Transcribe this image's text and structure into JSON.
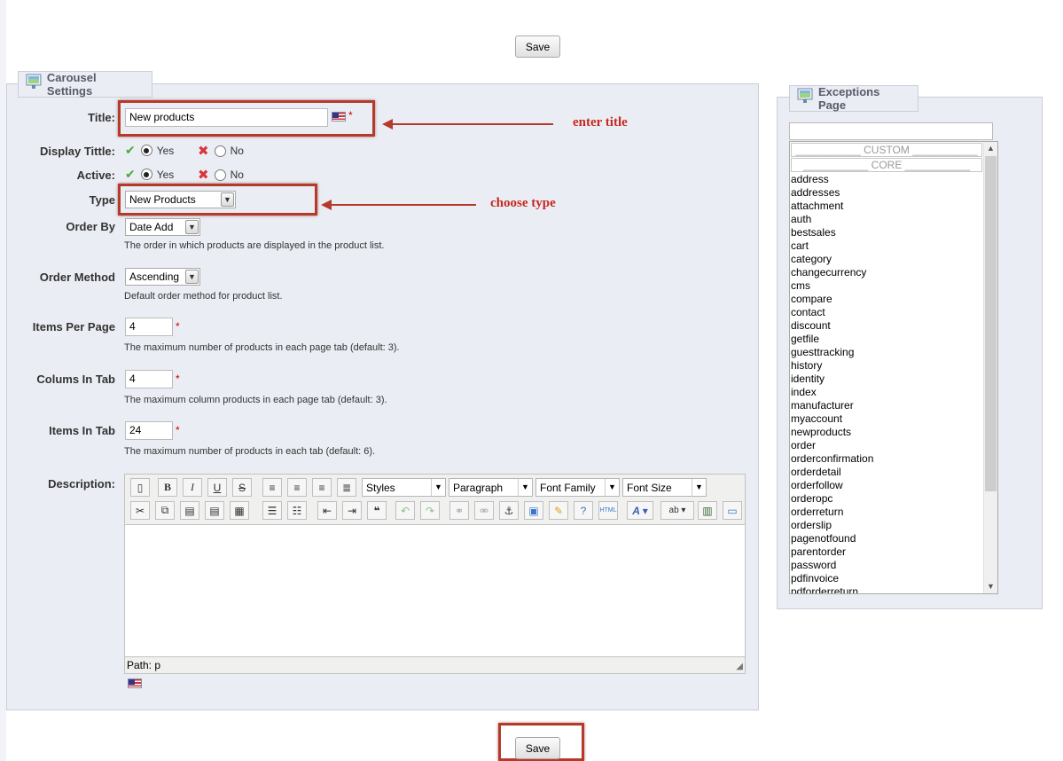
{
  "buttons": {
    "save_top": "Save",
    "save_bottom": "Save"
  },
  "carousel": {
    "legend": "Carousel Settings",
    "title_label": "Title:",
    "title_value": "New products",
    "display_title_label": "Display Tittle:",
    "active_label": "Active:",
    "yes": "Yes",
    "no": "No",
    "type_label": "Type",
    "type_value": "New Products",
    "order_by_label": "Order By",
    "order_by_value": "Date Add",
    "order_by_hint": "The order in which products are displayed in the product list.",
    "order_method_label": "Order Method",
    "order_method_value": "Ascending",
    "order_method_hint": "Default order method for product list.",
    "items_per_page_label": "Items Per Page",
    "items_per_page_value": "4",
    "items_per_page_hint": "The maximum number of products in each page tab (default: 3).",
    "columns_label": "Colums In Tab",
    "columns_value": "4",
    "columns_hint": "The maximum column products in each page tab (default: 3).",
    "items_in_tab_label": "Items In Tab",
    "items_in_tab_value": "24",
    "items_in_tab_hint": "The maximum number of products in each tab (default: 6).",
    "description_label": "Description:",
    "required_mark": "*"
  },
  "editor": {
    "styles": "Styles",
    "paragraph": "Paragraph",
    "font_family": "Font Family",
    "font_size": "Font Size",
    "path": "Path: p"
  },
  "annotations": {
    "enter_title": "enter title",
    "choose_type": "choose type"
  },
  "exceptions": {
    "legend": "Exceptions Page",
    "search_value": "",
    "separators": [
      "___________ CUSTOM ___________",
      "___________ CORE ___________"
    ],
    "items": [
      "address",
      "addresses",
      "attachment",
      "auth",
      "bestsales",
      "cart",
      "category",
      "changecurrency",
      "cms",
      "compare",
      "contact",
      "discount",
      "getfile",
      "guesttracking",
      "history",
      "identity",
      "index",
      "manufacturer",
      "myaccount",
      "newproducts",
      "order",
      "orderconfirmation",
      "orderdetail",
      "orderfollow",
      "orderopc",
      "orderreturn",
      "orderslip",
      "pagenotfound",
      "parentorder",
      "password",
      "pdfinvoice",
      "pdforderreturn"
    ]
  },
  "colors": {
    "annotation": "#b53a2b",
    "annotation_text": "#c5291f",
    "panel_bg": "#ebedf4"
  }
}
